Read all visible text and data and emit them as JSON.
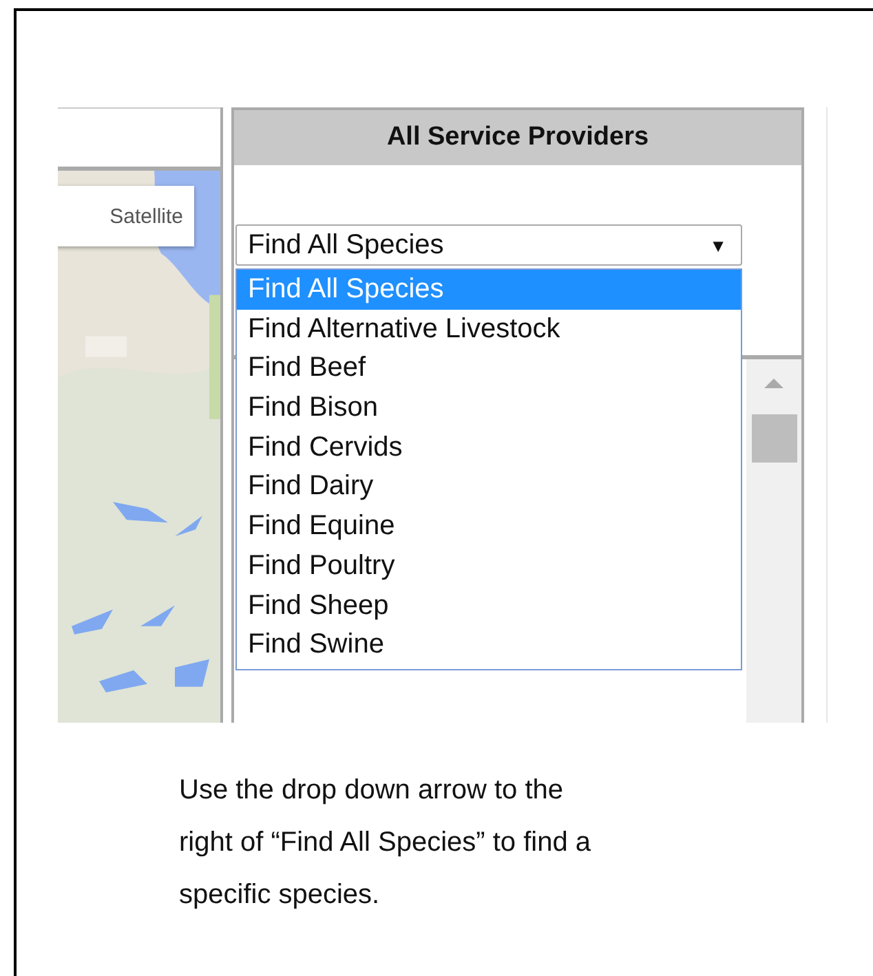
{
  "map": {
    "buttons": [
      {
        "label": "Satellite"
      }
    ]
  },
  "panel": {
    "title": "All Service Providers",
    "species_select": {
      "value": "Find All Species",
      "arrow": "▼",
      "expanded": true,
      "options": [
        {
          "label": "Find All Species",
          "selected": true
        },
        {
          "label": "Find Alternative Livestock",
          "selected": false
        },
        {
          "label": "Find Beef",
          "selected": false
        },
        {
          "label": "Find Bison",
          "selected": false
        },
        {
          "label": "Find Cervids",
          "selected": false
        },
        {
          "label": "Find Dairy",
          "selected": false
        },
        {
          "label": "Find Equine",
          "selected": false
        },
        {
          "label": "Find Poultry",
          "selected": false
        },
        {
          "label": "Find Sheep",
          "selected": false
        },
        {
          "label": "Find Swine",
          "selected": false
        }
      ]
    }
  },
  "caption_lines": [
    "Use the drop down arrow to the",
    "right of “Find All Species” to find a",
    "specific species."
  ]
}
